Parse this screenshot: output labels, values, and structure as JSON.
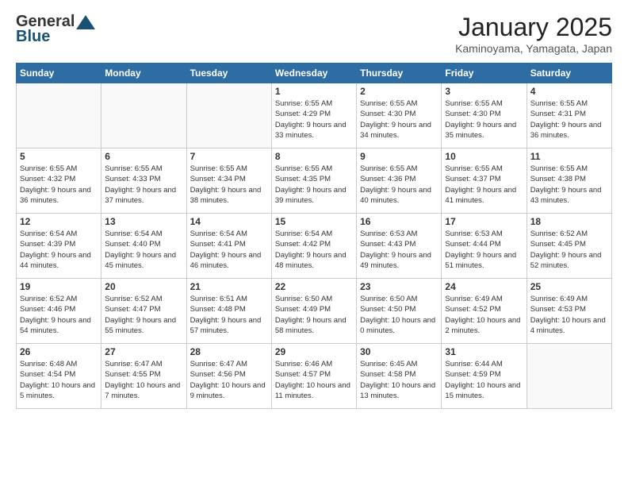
{
  "logo": {
    "general": "General",
    "blue": "Blue"
  },
  "header": {
    "month": "January 2025",
    "location": "Kaminoyama, Yamagata, Japan"
  },
  "weekdays": [
    "Sunday",
    "Monday",
    "Tuesday",
    "Wednesday",
    "Thursday",
    "Friday",
    "Saturday"
  ],
  "weeks": [
    [
      {
        "day": "",
        "info": ""
      },
      {
        "day": "",
        "info": ""
      },
      {
        "day": "",
        "info": ""
      },
      {
        "day": "1",
        "info": "Sunrise: 6:55 AM\nSunset: 4:29 PM\nDaylight: 9 hours and 33 minutes."
      },
      {
        "day": "2",
        "info": "Sunrise: 6:55 AM\nSunset: 4:30 PM\nDaylight: 9 hours and 34 minutes."
      },
      {
        "day": "3",
        "info": "Sunrise: 6:55 AM\nSunset: 4:30 PM\nDaylight: 9 hours and 35 minutes."
      },
      {
        "day": "4",
        "info": "Sunrise: 6:55 AM\nSunset: 4:31 PM\nDaylight: 9 hours and 36 minutes."
      }
    ],
    [
      {
        "day": "5",
        "info": "Sunrise: 6:55 AM\nSunset: 4:32 PM\nDaylight: 9 hours and 36 minutes."
      },
      {
        "day": "6",
        "info": "Sunrise: 6:55 AM\nSunset: 4:33 PM\nDaylight: 9 hours and 37 minutes."
      },
      {
        "day": "7",
        "info": "Sunrise: 6:55 AM\nSunset: 4:34 PM\nDaylight: 9 hours and 38 minutes."
      },
      {
        "day": "8",
        "info": "Sunrise: 6:55 AM\nSunset: 4:35 PM\nDaylight: 9 hours and 39 minutes."
      },
      {
        "day": "9",
        "info": "Sunrise: 6:55 AM\nSunset: 4:36 PM\nDaylight: 9 hours and 40 minutes."
      },
      {
        "day": "10",
        "info": "Sunrise: 6:55 AM\nSunset: 4:37 PM\nDaylight: 9 hours and 41 minutes."
      },
      {
        "day": "11",
        "info": "Sunrise: 6:55 AM\nSunset: 4:38 PM\nDaylight: 9 hours and 43 minutes."
      }
    ],
    [
      {
        "day": "12",
        "info": "Sunrise: 6:54 AM\nSunset: 4:39 PM\nDaylight: 9 hours and 44 minutes."
      },
      {
        "day": "13",
        "info": "Sunrise: 6:54 AM\nSunset: 4:40 PM\nDaylight: 9 hours and 45 minutes."
      },
      {
        "day": "14",
        "info": "Sunrise: 6:54 AM\nSunset: 4:41 PM\nDaylight: 9 hours and 46 minutes."
      },
      {
        "day": "15",
        "info": "Sunrise: 6:54 AM\nSunset: 4:42 PM\nDaylight: 9 hours and 48 minutes."
      },
      {
        "day": "16",
        "info": "Sunrise: 6:53 AM\nSunset: 4:43 PM\nDaylight: 9 hours and 49 minutes."
      },
      {
        "day": "17",
        "info": "Sunrise: 6:53 AM\nSunset: 4:44 PM\nDaylight: 9 hours and 51 minutes."
      },
      {
        "day": "18",
        "info": "Sunrise: 6:52 AM\nSunset: 4:45 PM\nDaylight: 9 hours and 52 minutes."
      }
    ],
    [
      {
        "day": "19",
        "info": "Sunrise: 6:52 AM\nSunset: 4:46 PM\nDaylight: 9 hours and 54 minutes."
      },
      {
        "day": "20",
        "info": "Sunrise: 6:52 AM\nSunset: 4:47 PM\nDaylight: 9 hours and 55 minutes."
      },
      {
        "day": "21",
        "info": "Sunrise: 6:51 AM\nSunset: 4:48 PM\nDaylight: 9 hours and 57 minutes."
      },
      {
        "day": "22",
        "info": "Sunrise: 6:50 AM\nSunset: 4:49 PM\nDaylight: 9 hours and 58 minutes."
      },
      {
        "day": "23",
        "info": "Sunrise: 6:50 AM\nSunset: 4:50 PM\nDaylight: 10 hours and 0 minutes."
      },
      {
        "day": "24",
        "info": "Sunrise: 6:49 AM\nSunset: 4:52 PM\nDaylight: 10 hours and 2 minutes."
      },
      {
        "day": "25",
        "info": "Sunrise: 6:49 AM\nSunset: 4:53 PM\nDaylight: 10 hours and 4 minutes."
      }
    ],
    [
      {
        "day": "26",
        "info": "Sunrise: 6:48 AM\nSunset: 4:54 PM\nDaylight: 10 hours and 5 minutes."
      },
      {
        "day": "27",
        "info": "Sunrise: 6:47 AM\nSunset: 4:55 PM\nDaylight: 10 hours and 7 minutes."
      },
      {
        "day": "28",
        "info": "Sunrise: 6:47 AM\nSunset: 4:56 PM\nDaylight: 10 hours and 9 minutes."
      },
      {
        "day": "29",
        "info": "Sunrise: 6:46 AM\nSunset: 4:57 PM\nDaylight: 10 hours and 11 minutes."
      },
      {
        "day": "30",
        "info": "Sunrise: 6:45 AM\nSunset: 4:58 PM\nDaylight: 10 hours and 13 minutes."
      },
      {
        "day": "31",
        "info": "Sunrise: 6:44 AM\nSunset: 4:59 PM\nDaylight: 10 hours and 15 minutes."
      },
      {
        "day": "",
        "info": ""
      }
    ]
  ]
}
